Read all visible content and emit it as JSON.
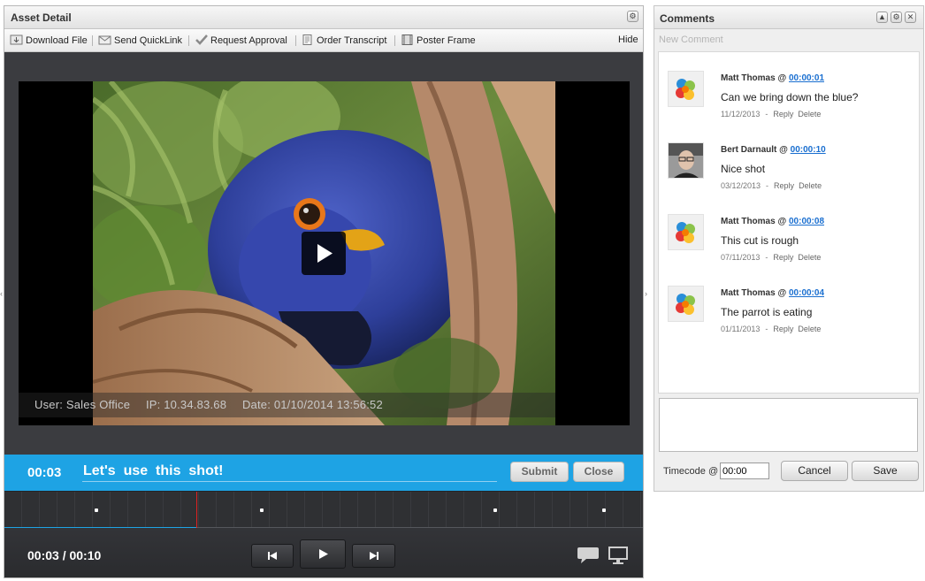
{
  "asset": {
    "title": "Asset Detail",
    "toolbar": {
      "download": "Download File",
      "quicklink": "Send QuickLink",
      "approval": "Request Approval",
      "transcript": "Order Transcript",
      "poster": "Poster Frame",
      "hide": "Hide"
    },
    "watermark": {
      "user": "User: Sales Office",
      "ip": "IP: 10.34.83.68",
      "date": "Date: 01/10/2014 13:56:52"
    },
    "comment_bar": {
      "timecode": "00:03",
      "text": "Let's  use  this  shot!",
      "submit": "Submit",
      "close": "Close"
    },
    "timeline": {
      "progress_fraction": 0.3
    },
    "controls": {
      "time": "00:03 / 00:10"
    }
  },
  "comments_panel": {
    "title": "Comments",
    "new_comment": "New Comment",
    "items": [
      {
        "author": "Matt Thomas @ ",
        "timecode": "00:00:01",
        "text": "Can we bring down the blue?",
        "date": "11/12/2013",
        "reply": "Reply",
        "delete": "Delete",
        "avatar": "logo"
      },
      {
        "author": "Bert Darnault @ ",
        "timecode": "00:00:10",
        "text": "Nice shot",
        "date": "03/12/2013",
        "reply": "Reply",
        "delete": "Delete",
        "avatar": "photo"
      },
      {
        "author": "Matt Thomas @ ",
        "timecode": "00:00:08",
        "text": "This cut is rough",
        "date": "07/11/2013",
        "reply": "Reply",
        "delete": "Delete",
        "avatar": "logo"
      },
      {
        "author": "Matt Thomas @ ",
        "timecode": "00:00:04",
        "text": "The parrot is eating",
        "date": "01/11/2013",
        "reply": "Reply",
        "delete": "Delete",
        "avatar": "logo"
      }
    ],
    "timecode_label": "Timecode @",
    "timecode_value": "00:00",
    "cancel": "Cancel",
    "save": "Save"
  },
  "colors": {
    "accent_blue": "#1ea3e4",
    "playhead_red": "#dd2222",
    "link_blue": "#1a6fd0"
  }
}
